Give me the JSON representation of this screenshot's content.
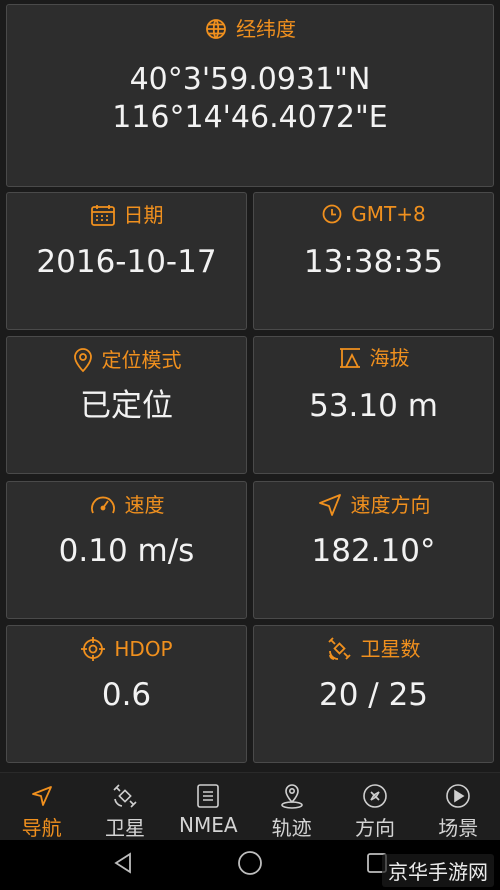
{
  "cards": {
    "coordinates": {
      "title": "经纬度",
      "lat": "40°3'59.0931\"N",
      "lon": "116°14'46.4072\"E"
    },
    "date": {
      "title": "日期",
      "value": "2016-10-17"
    },
    "time": {
      "title": "GMT+8",
      "value": "13:38:35"
    },
    "mode": {
      "title": "定位模式",
      "value": "已定位"
    },
    "altitude": {
      "title": "海拔",
      "value": "53.10 m"
    },
    "speed": {
      "title": "速度",
      "value": "0.10 m/s"
    },
    "heading": {
      "title": "速度方向",
      "value": "182.10°"
    },
    "hdop": {
      "title": "HDOP",
      "value": "0.6"
    },
    "satellites": {
      "title": "卫星数",
      "value": "20 / 25"
    }
  },
  "nav": {
    "items": [
      {
        "label": "导航",
        "icon": "navigation-arrow-icon",
        "active": true
      },
      {
        "label": "卫星",
        "icon": "satellite-icon"
      },
      {
        "label": "NMEA",
        "icon": "document-icon"
      },
      {
        "label": "轨迹",
        "icon": "location-pin-icon"
      },
      {
        "label": "方向",
        "icon": "compass-icon"
      },
      {
        "label": "场景",
        "icon": "play-icon"
      }
    ]
  },
  "watermark": "京华手游网",
  "colors": {
    "accent": "#f0901e",
    "card": "#2d2d2d",
    "text": "#f2f2f2"
  }
}
